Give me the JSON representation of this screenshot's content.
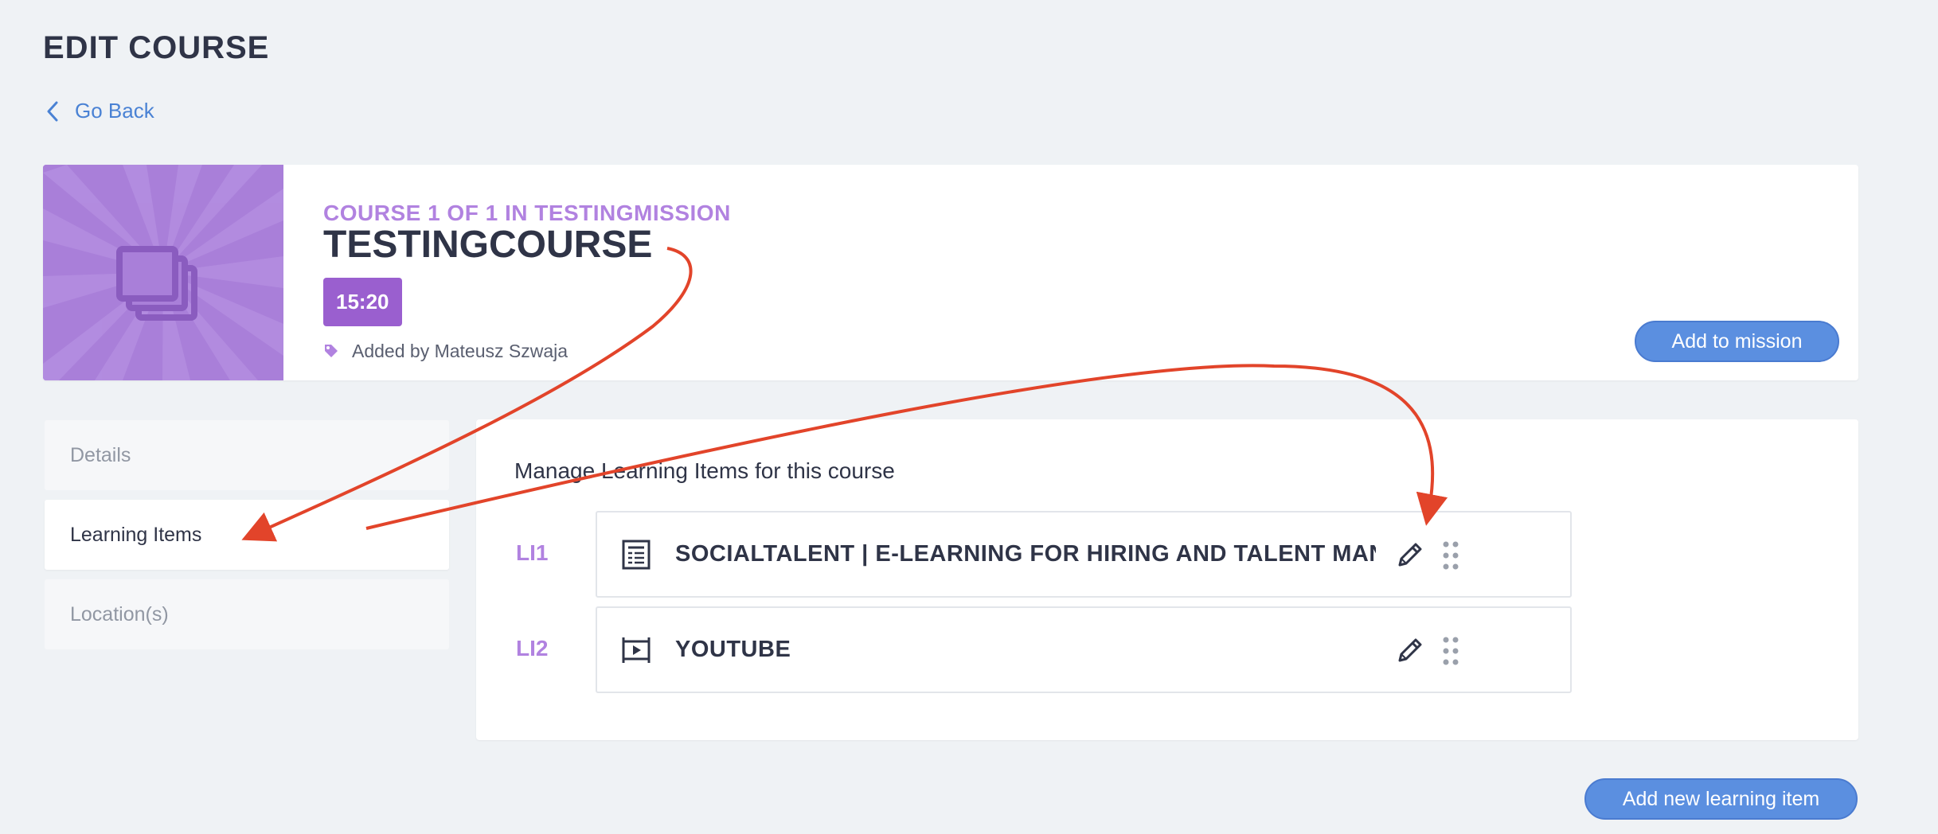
{
  "header": {
    "title": "EDIT COURSE",
    "back_label": "Go Back"
  },
  "course": {
    "subtitle": "COURSE 1 OF 1 IN TESTINGMISSION",
    "name": "TESTINGCOURSE",
    "duration": "15:20",
    "added_by": "Added by Mateusz Szwaja",
    "add_to_mission_label": "Add to mission"
  },
  "tabs": [
    {
      "label": "Details",
      "active": false
    },
    {
      "label": "Learning Items",
      "active": true
    },
    {
      "label": "Location(s)",
      "active": false
    }
  ],
  "learning_items": {
    "heading": "Manage Learning Items for this course",
    "items": [
      {
        "code": "LI1",
        "type_icon": "document-icon",
        "title": "SOCIALTALENT | E-LEARNING FOR HIRING AND TALENT MANA..."
      },
      {
        "code": "LI2",
        "type_icon": "video-icon",
        "title": "YOUTUBE"
      }
    ],
    "add_label": "Add new learning item"
  },
  "colors": {
    "accent_purple": "#b182e0",
    "badge_purple": "#9a5fcf",
    "button_blue": "#5b8fe0",
    "annotation_red": "#e2442a"
  }
}
